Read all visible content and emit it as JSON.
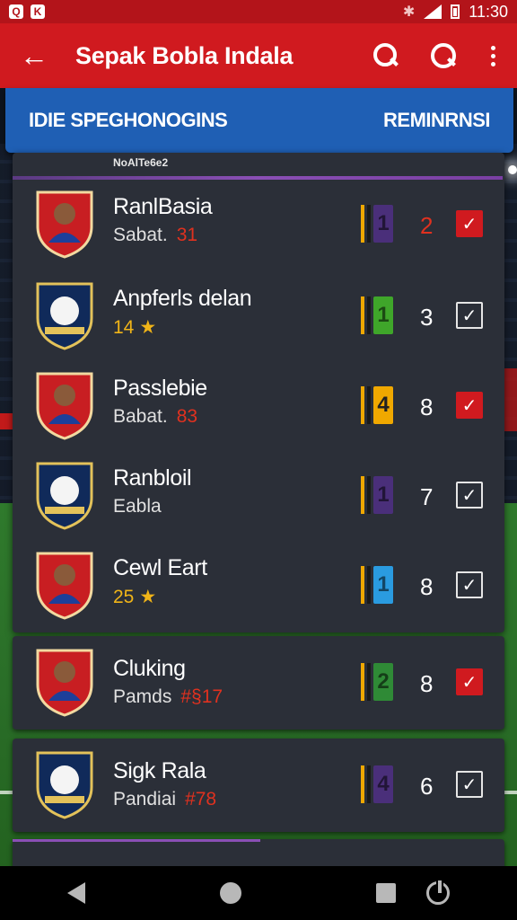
{
  "status_bar": {
    "time": "11:30"
  },
  "app_bar": {
    "title": "Sepak Bobla Indala"
  },
  "tabs": {
    "left": "IDIE SPEGHONOGINS",
    "right": "REMINRNSI"
  },
  "list": {
    "sub_label": "NoAlTe6e2",
    "teams": [
      {
        "name": "RanlBasia",
        "sub_text": "Sabat.",
        "sub_value": "31",
        "sub_value_color": "#e0311f",
        "bar_value": "1",
        "bar_color": "#4a2f7a",
        "count": "2",
        "count_color": "#e0311f",
        "checked": true,
        "crest_icon": "player-crest-icon"
      },
      {
        "name": "Anpferls delan",
        "sub_text": "",
        "sub_value": "14",
        "sub_value_color": "#f0b418",
        "star": "★",
        "bar_value": "1",
        "bar_color": "#3fa62a",
        "count": "3",
        "count_color": "#ffffff",
        "checked": false,
        "crest_icon": "club-crest-icon"
      },
      {
        "name": "Passlebie",
        "sub_text": "Babat.",
        "sub_value": "83",
        "sub_value_color": "#e0311f",
        "bar_value": "4",
        "bar_color": "#f0a800",
        "count": "8",
        "count_color": "#ffffff",
        "checked": true,
        "crest_icon": "player-crest-icon"
      },
      {
        "name": "Ranbloil",
        "sub_text": "Eabla",
        "sub_value": "",
        "sub_value_color": "#e0e0e0",
        "bar_value": "1",
        "bar_color": "#4a2f7a",
        "count": "7",
        "count_color": "#ffffff",
        "checked": false,
        "crest_icon": "club-crest-icon"
      },
      {
        "name": "Cewl Eart",
        "sub_text": "",
        "sub_value": "25",
        "sub_value_color": "#f0b418",
        "star": "★",
        "bar_value": "1",
        "bar_color": "#2a9be0",
        "count": "8",
        "count_color": "#ffffff",
        "checked": false,
        "crest_icon": "player-crest-icon"
      },
      {
        "name": "Cluking",
        "sub_text": "Pamds",
        "sub_value": "#§17",
        "sub_value_color": "#e0311f",
        "bar_value": "2",
        "bar_color": "#2f8a36",
        "count": "8",
        "count_color": "#ffffff",
        "checked": true,
        "crest_icon": "player-crest-icon"
      },
      {
        "name": "Sigk Rala",
        "sub_text": "Pandiai",
        "sub_value": "#78",
        "sub_value_color": "#e0311f",
        "bar_value": "4",
        "bar_color": "#4a2f7a",
        "count": "6",
        "count_color": "#ffffff",
        "checked": false,
        "crest_icon": "club-crest-icon"
      }
    ]
  },
  "check_glyph": "✓"
}
